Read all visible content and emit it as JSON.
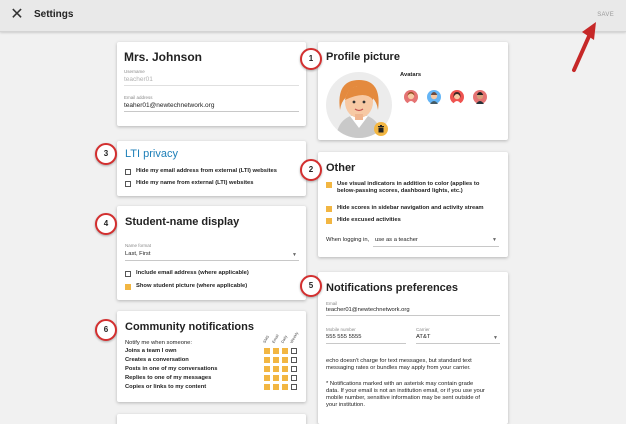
{
  "topbar": {
    "close_icon": "close-icon",
    "title": "Settings",
    "save_label": "SAVE"
  },
  "profile": {
    "name": "Mrs. Johnson",
    "username_label": "Username",
    "username_value": "teacher01",
    "email_label": "Email address",
    "email_value": "teaher01@newtechnetwork.org"
  },
  "picture": {
    "title": "Profile picture",
    "avatars_label": "Avatars",
    "badge": "1"
  },
  "lti": {
    "title": "LTI privacy",
    "badge": "3",
    "options": [
      {
        "label": "Hide my email address from external (LTI) websites",
        "checked": false
      },
      {
        "label": "Hide my name from external (LTI) websites",
        "checked": false
      }
    ]
  },
  "other": {
    "title": "Other",
    "badge": "2",
    "options": [
      {
        "label": "Use visual indicators in addition to color (applies to",
        "label2": "below-passing scores, dashboard lights, etc.)",
        "checked": true
      },
      {
        "label": "Hide scores in sidebar navigation and activity stream",
        "checked": true
      },
      {
        "label": "Hide excused activities",
        "checked": true
      }
    ],
    "login_label": "When logging in,",
    "login_value": "use as a teacher"
  },
  "student": {
    "title": "Student-name display",
    "badge": "4",
    "format_label": "Name format",
    "format_value": "Last, First",
    "options": [
      {
        "label": "Include email address (where applicable)",
        "checked": false
      },
      {
        "label": "Show student picture (where applicable)",
        "checked": true
      }
    ]
  },
  "notif": {
    "title": "Notifications preferences",
    "badge": "5",
    "email_label": "Email",
    "email_value": "teacher01@newtechnetwork.org",
    "mobile_label": "Mobile number",
    "mobile_value": "555 555 5555",
    "carrier_label": "Carrier",
    "carrier_value": "AT&T",
    "note1a": "echo doesn't charge for text messages, but standard text",
    "note1b": "messaging rates or bundles may apply from your carrier.",
    "note2a": "* Notifications marked with an asterisk may contain grade",
    "note2b": "data. If your email is not an institution email, or if you use your",
    "note2c": "mobile number, sensitive information may be sent outside of",
    "note2d": "your institution."
  },
  "community": {
    "title": "Community notifications",
    "badge": "6",
    "intro": "Notify me when someone:",
    "columns": [
      "SMS",
      "Email",
      "Daily",
      "Weekly"
    ],
    "rows": [
      {
        "label": "Joins a team I own",
        "checks": [
          true,
          true,
          true,
          false
        ]
      },
      {
        "label": "Creates a conversation",
        "checks": [
          true,
          true,
          true,
          false
        ]
      },
      {
        "label": "Posts in one of my conversations",
        "checks": [
          true,
          true,
          true,
          false
        ]
      },
      {
        "label": "Replies to one of my messages",
        "checks": [
          true,
          true,
          true,
          false
        ]
      },
      {
        "label": "Copies or links to my content",
        "checks": [
          true,
          true,
          true,
          false
        ]
      }
    ]
  },
  "colors": {
    "accent": "#f2b642",
    "badge_ring": "#d32f2f",
    "link_blue": "#1d7fb8"
  }
}
